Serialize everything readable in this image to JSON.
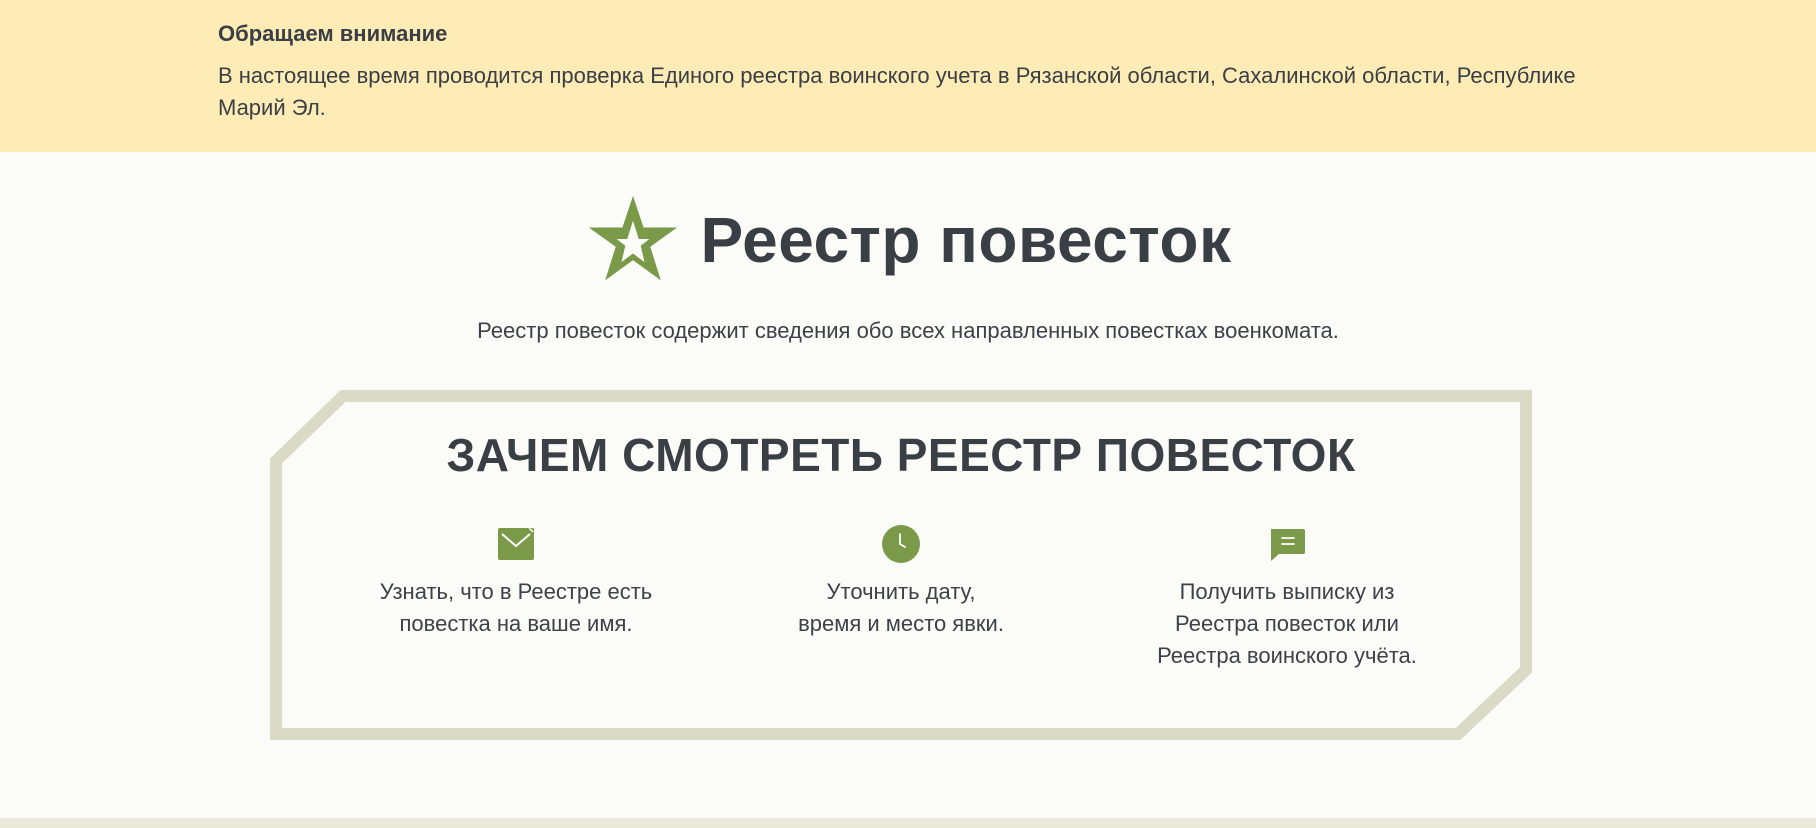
{
  "notice": {
    "title": "Обращаем внимание",
    "text": "В настоящее время проводится проверка Единого реестра воинского учета в Рязанской области, Сахалинской области, Республике Марий Эл."
  },
  "hero": {
    "logo_icon": "star-logo-icon",
    "title": "Реестр повесток",
    "subtitle": "Реестр повесток содержит сведения обо всех направленных повестках военкомата."
  },
  "why": {
    "title": "ЗАЧЕМ СМОТРЕТЬ РЕЕСТР ПОВЕСТОК",
    "features": [
      {
        "icon": "envelope-check-icon",
        "text": "Узнать, что в Реестре есть\nповестка на ваше имя."
      },
      {
        "icon": "clock-icon",
        "text": "Уточнить дату,\nвремя и место явки."
      },
      {
        "icon": "chat-message-icon",
        "text": "Получить выписку из\nРеестра повесток или\nРеестра воинского учёта."
      }
    ]
  },
  "colors": {
    "notice_bg": "#fdecb5",
    "accent_green": "#7a9a4a",
    "frame_border": "#d9dbc6",
    "text_dark": "#3a3e45",
    "page_bg": "#fbfbf8"
  }
}
